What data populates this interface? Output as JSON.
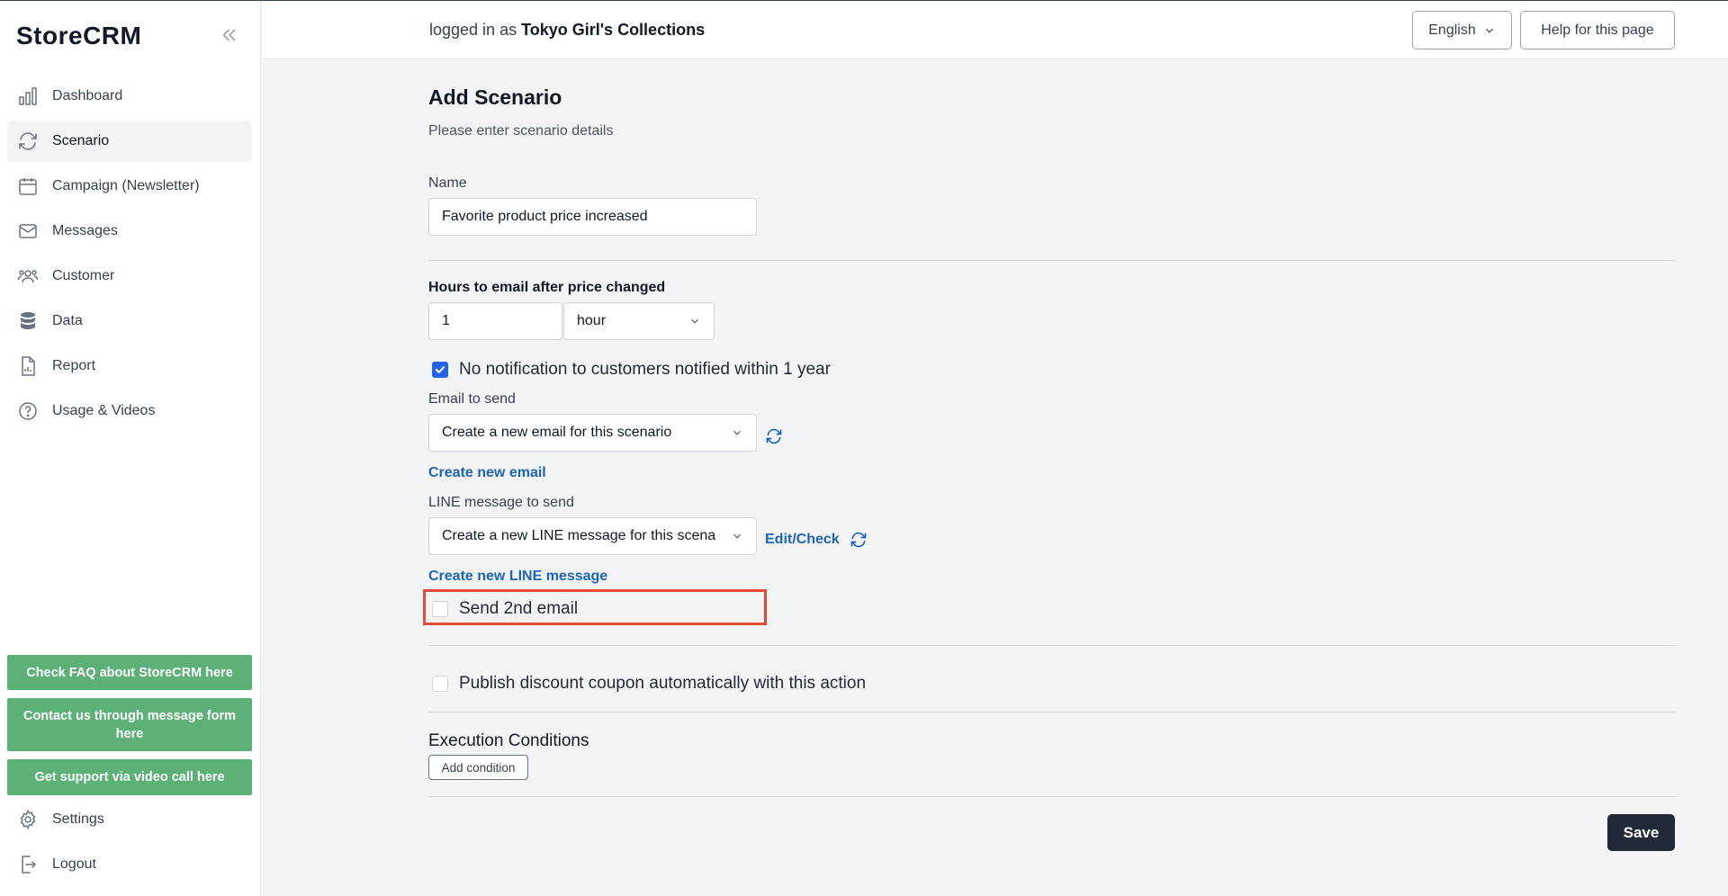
{
  "app": {
    "logo": "StoreCRM"
  },
  "sidebar": {
    "items": [
      {
        "label": "Dashboard",
        "icon": "chart-bar-icon"
      },
      {
        "label": "Scenario",
        "icon": "refresh-icon",
        "active": true
      },
      {
        "label": "Campaign (Newsletter)",
        "icon": "calendar-icon"
      },
      {
        "label": "Messages",
        "icon": "mail-icon"
      },
      {
        "label": "Customer",
        "icon": "users-icon"
      },
      {
        "label": "Data",
        "icon": "database-icon"
      },
      {
        "label": "Report",
        "icon": "document-chart-icon"
      },
      {
        "label": "Usage & Videos",
        "icon": "question-circle-icon"
      }
    ],
    "support_buttons": [
      "Check FAQ about StoreCRM here",
      "Contact us through message form here",
      "Get support via video call here"
    ],
    "bottom_items": [
      {
        "label": "Settings",
        "icon": "gear-icon"
      },
      {
        "label": "Logout",
        "icon": "logout-icon"
      }
    ]
  },
  "header": {
    "logged_prefix": "logged in as",
    "store_name": "Tokyo Girl's Collections",
    "language": "English",
    "help": "Help for this page"
  },
  "form": {
    "title": "Add Scenario",
    "subtitle": "Please enter scenario details",
    "name_label": "Name",
    "name_value": "Favorite product price increased",
    "hours_label": "Hours to email after price changed",
    "hours_value": "1",
    "hours_unit": "hour",
    "no_notification_label": "No notification to customers notified within 1 year",
    "no_notification_checked": true,
    "email_label": "Email to send",
    "email_value": "Create a new email for this scenario",
    "create_email_link": "Create new email",
    "line_label": "LINE message to send",
    "line_value": "Create a new LINE message for this scenario",
    "edit_check": "Edit/Check",
    "create_line_link": "Create new LINE message",
    "second_email_label": "Send 2nd email",
    "second_email_checked": false,
    "coupon_label": "Publish discount coupon automatically with this action",
    "coupon_checked": false,
    "conditions_title": "Execution Conditions",
    "add_condition": "Add condition",
    "save": "Save"
  },
  "colors": {
    "accent_blue": "#1d63c0",
    "checkbox_blue": "#2563eb",
    "support_green": "#5cb176",
    "save_dark": "#1f2937",
    "highlight_red": "#e34b3b"
  }
}
